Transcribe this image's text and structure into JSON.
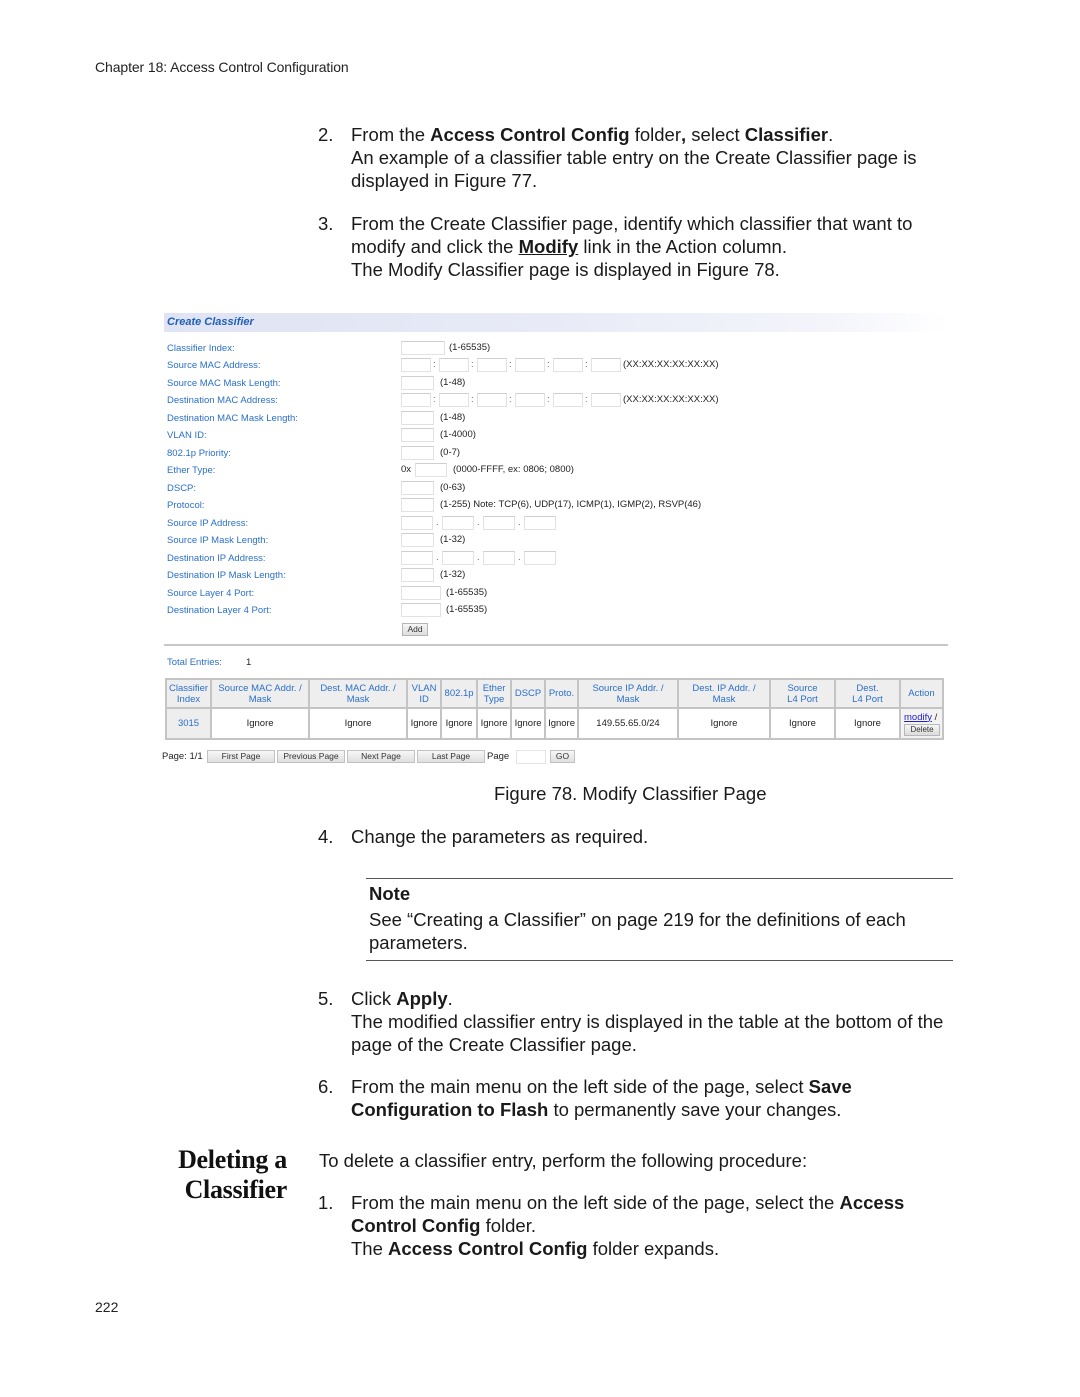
{
  "running_head": "Chapter 18: Access Control Configuration",
  "page_number": "222",
  "steps_top": [
    {
      "num": "2.",
      "line1_pre": "From the ",
      "line1_b1": "Access Control Config",
      "line1_mid": " folder",
      "line1_comma": ",",
      "line1_mid2": " select ",
      "line1_b2": "Classifier",
      "line1_end": ".",
      "line2": "An example of a classifier table entry on the Create Classifier page is displayed in Figure 77."
    },
    {
      "num": "3.",
      "line1": "From the Create Classifier page, identify which classifier that want to modify and click the ",
      "link": "Modify",
      "line1_end": " link in the Action column.",
      "line2": "The Modify Classifier page is displayed in Figure 78."
    }
  ],
  "figure": {
    "header": "Create Classifier",
    "fields": [
      {
        "label": "Classifier Index:",
        "hint": "(1-65535)"
      },
      {
        "label": "Source MAC Address:",
        "hint": "(XX:XX:XX:XX:XX:XX)"
      },
      {
        "label": "Source MAC Mask Length:",
        "hint": "(1-48)"
      },
      {
        "label": "Destination MAC Address:",
        "hint": "(XX:XX:XX:XX:XX:XX)"
      },
      {
        "label": "Destination MAC Mask Length:",
        "hint": "(1-48)"
      },
      {
        "label": "VLAN ID:",
        "hint": "(1-4000)"
      },
      {
        "label": "802.1p Priority:",
        "hint": "(0-7)"
      },
      {
        "label": "Ether Type:",
        "prefix": "0x",
        "hint": "(0000-FFFF, ex: 0806; 0800)"
      },
      {
        "label": "DSCP:",
        "hint": "(0-63)"
      },
      {
        "label": "Protocol:",
        "hint": "(1-255) Note: TCP(6), UDP(17), ICMP(1), IGMP(2), RSVP(46)"
      },
      {
        "label": "Source IP Address:",
        "hint": ""
      },
      {
        "label": "Source IP Mask Length:",
        "hint": "(1-32)"
      },
      {
        "label": "Destination IP Address:",
        "hint": ""
      },
      {
        "label": "Destination IP Mask Length:",
        "hint": "(1-32)"
      },
      {
        "label": "Source Layer 4 Port:",
        "hint": "(1-65535)"
      },
      {
        "label": "Destination Layer 4 Port:",
        "hint": "(1-65535)"
      }
    ],
    "mac_sep": ":",
    "ip_sep": ".",
    "add_button": "Add",
    "total_entries_label": "Total Entries:",
    "total_entries_value": "1",
    "table": {
      "headers": [
        [
          "Classifier",
          "Index"
        ],
        [
          "Source MAC Addr. /",
          "Mask"
        ],
        [
          "Dest. MAC Addr. /",
          "Mask"
        ],
        [
          "VLAN",
          "ID"
        ],
        [
          "802.1p",
          ""
        ],
        [
          "Ether",
          "Type"
        ],
        [
          "DSCP",
          ""
        ],
        [
          "Proto.",
          ""
        ],
        [
          "Source IP Addr. /",
          "Mask"
        ],
        [
          "Dest. IP Addr. /",
          "Mask"
        ],
        [
          "Source",
          "L4 Port"
        ],
        [
          "Dest.",
          "L4 Port"
        ],
        [
          "Action",
          ""
        ]
      ],
      "rows": [
        {
          "cells": [
            "3015",
            "Ignore",
            "Ignore",
            "Ignore",
            "Ignore",
            "Ignore",
            "Ignore",
            "Ignore",
            "149.55.65.0/24",
            "Ignore",
            "Ignore",
            "Ignore"
          ],
          "modify": "modify",
          "slash": " /",
          "delete": "Delete"
        }
      ]
    },
    "pager": {
      "label": "Page: 1/1",
      "first": "First Page",
      "previous": "Previous Page",
      "next": "Next Page",
      "last": "Last Page",
      "page_word": "Page",
      "page_input_value": "",
      "go": "GO"
    }
  },
  "caption": "Figure 78. Modify Classifier Page",
  "step4": {
    "num": "4.",
    "text": "Change the parameters as required."
  },
  "note": {
    "title": "Note",
    "text": "See “Creating a Classifier” on page 219 for the definitions of each parameters."
  },
  "step5": {
    "num": "5.",
    "pre": "Click ",
    "bold": "Apply",
    "end": ".",
    "line2": "The modified classifier entry is displayed in the table at the bottom of the page of the Create Classifier page."
  },
  "step6": {
    "num": "6.",
    "pre": "From the main menu on the left side of the page, select ",
    "bold": "Save Configuration to Flash",
    "end": " to permanently save your changes."
  },
  "section": {
    "heading_line1": "Deleting a",
    "heading_line2": "Classifier",
    "intro": "To delete a classifier entry, perform the following procedure:",
    "step1": {
      "num": "1.",
      "pre": "From the main menu on the left side of the page, select the ",
      "bold": "Access Control Config",
      "end": " folder.",
      "line2_pre": "The ",
      "line2_bold": "Access Control Config",
      "line2_end": " folder expands."
    }
  }
}
